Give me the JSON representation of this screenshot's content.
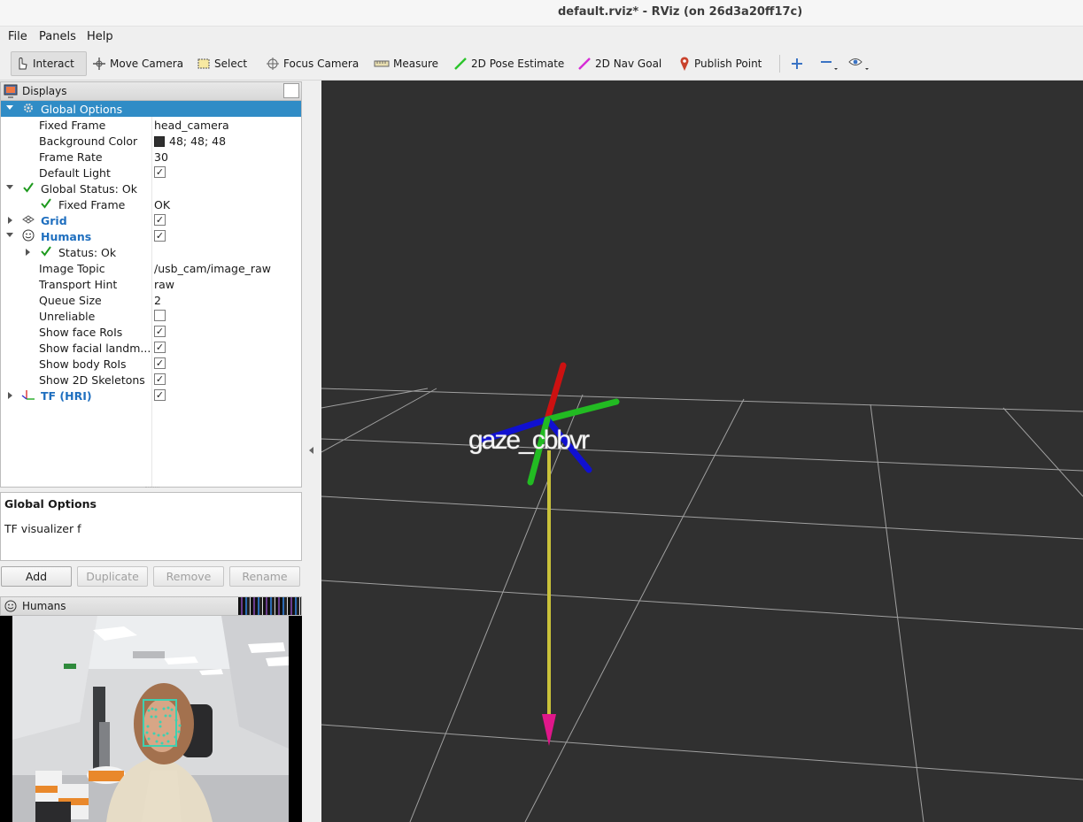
{
  "window": {
    "title": "default.rviz* - RViz (on 26d3a20ff17c)"
  },
  "menu": [
    "File",
    "Panels",
    "Help"
  ],
  "toolbar": {
    "interact": "Interact",
    "move_camera": "Move Camera",
    "select": "Select",
    "focus_camera": "Focus Camera",
    "measure": "Measure",
    "pose_estimate": "2D Pose Estimate",
    "nav_goal": "2D Nav Goal",
    "publish_point": "Publish Point"
  },
  "displays": {
    "title": "Displays",
    "global_options": "Global Options",
    "fixed_frame": {
      "label": "Fixed Frame",
      "value": "head_camera"
    },
    "background_color": {
      "label": "Background Color",
      "value": "48; 48; 48",
      "color": "#303030"
    },
    "frame_rate": {
      "label": "Frame Rate",
      "value": "30"
    },
    "default_light": {
      "label": "Default Light",
      "checked": true
    },
    "global_status": "Global Status: Ok",
    "status_fixed_frame": {
      "label": "Fixed Frame",
      "value": "OK"
    },
    "grid": {
      "label": "Grid",
      "checked": true
    },
    "humans": {
      "label": "Humans",
      "checked": true
    },
    "humans_status": "Status: Ok",
    "image_topic": {
      "label": "Image Topic",
      "value": "/usb_cam/image_raw"
    },
    "transport_hint": {
      "label": "Transport Hint",
      "value": "raw"
    },
    "queue_size": {
      "label": "Queue Size",
      "value": "2"
    },
    "unreliable": {
      "label": "Unreliable",
      "checked": false
    },
    "show_face_rois": {
      "label": "Show face RoIs",
      "checked": true
    },
    "show_facial_landmarks": {
      "label": "Show facial landm...",
      "checked": true
    },
    "show_body_rois": {
      "label": "Show body RoIs",
      "checked": true
    },
    "show_2d_skeletons": {
      "label": "Show 2D Skeletons",
      "checked": true
    },
    "tf_hri": {
      "label": "TF (HRI)",
      "checked": true
    }
  },
  "description": {
    "heading": "Global Options",
    "text": "TF visualizer f"
  },
  "buttons": {
    "add": "Add",
    "duplicate": "Duplicate",
    "remove": "Remove",
    "rename": "Rename"
  },
  "humans_panel": {
    "title": "Humans"
  },
  "scene": {
    "frame_label": "gaze_cbbvr",
    "background": "#303030"
  },
  "colors": {
    "selection": "#308cc6",
    "display_name_blue": "#1f6fbf"
  }
}
